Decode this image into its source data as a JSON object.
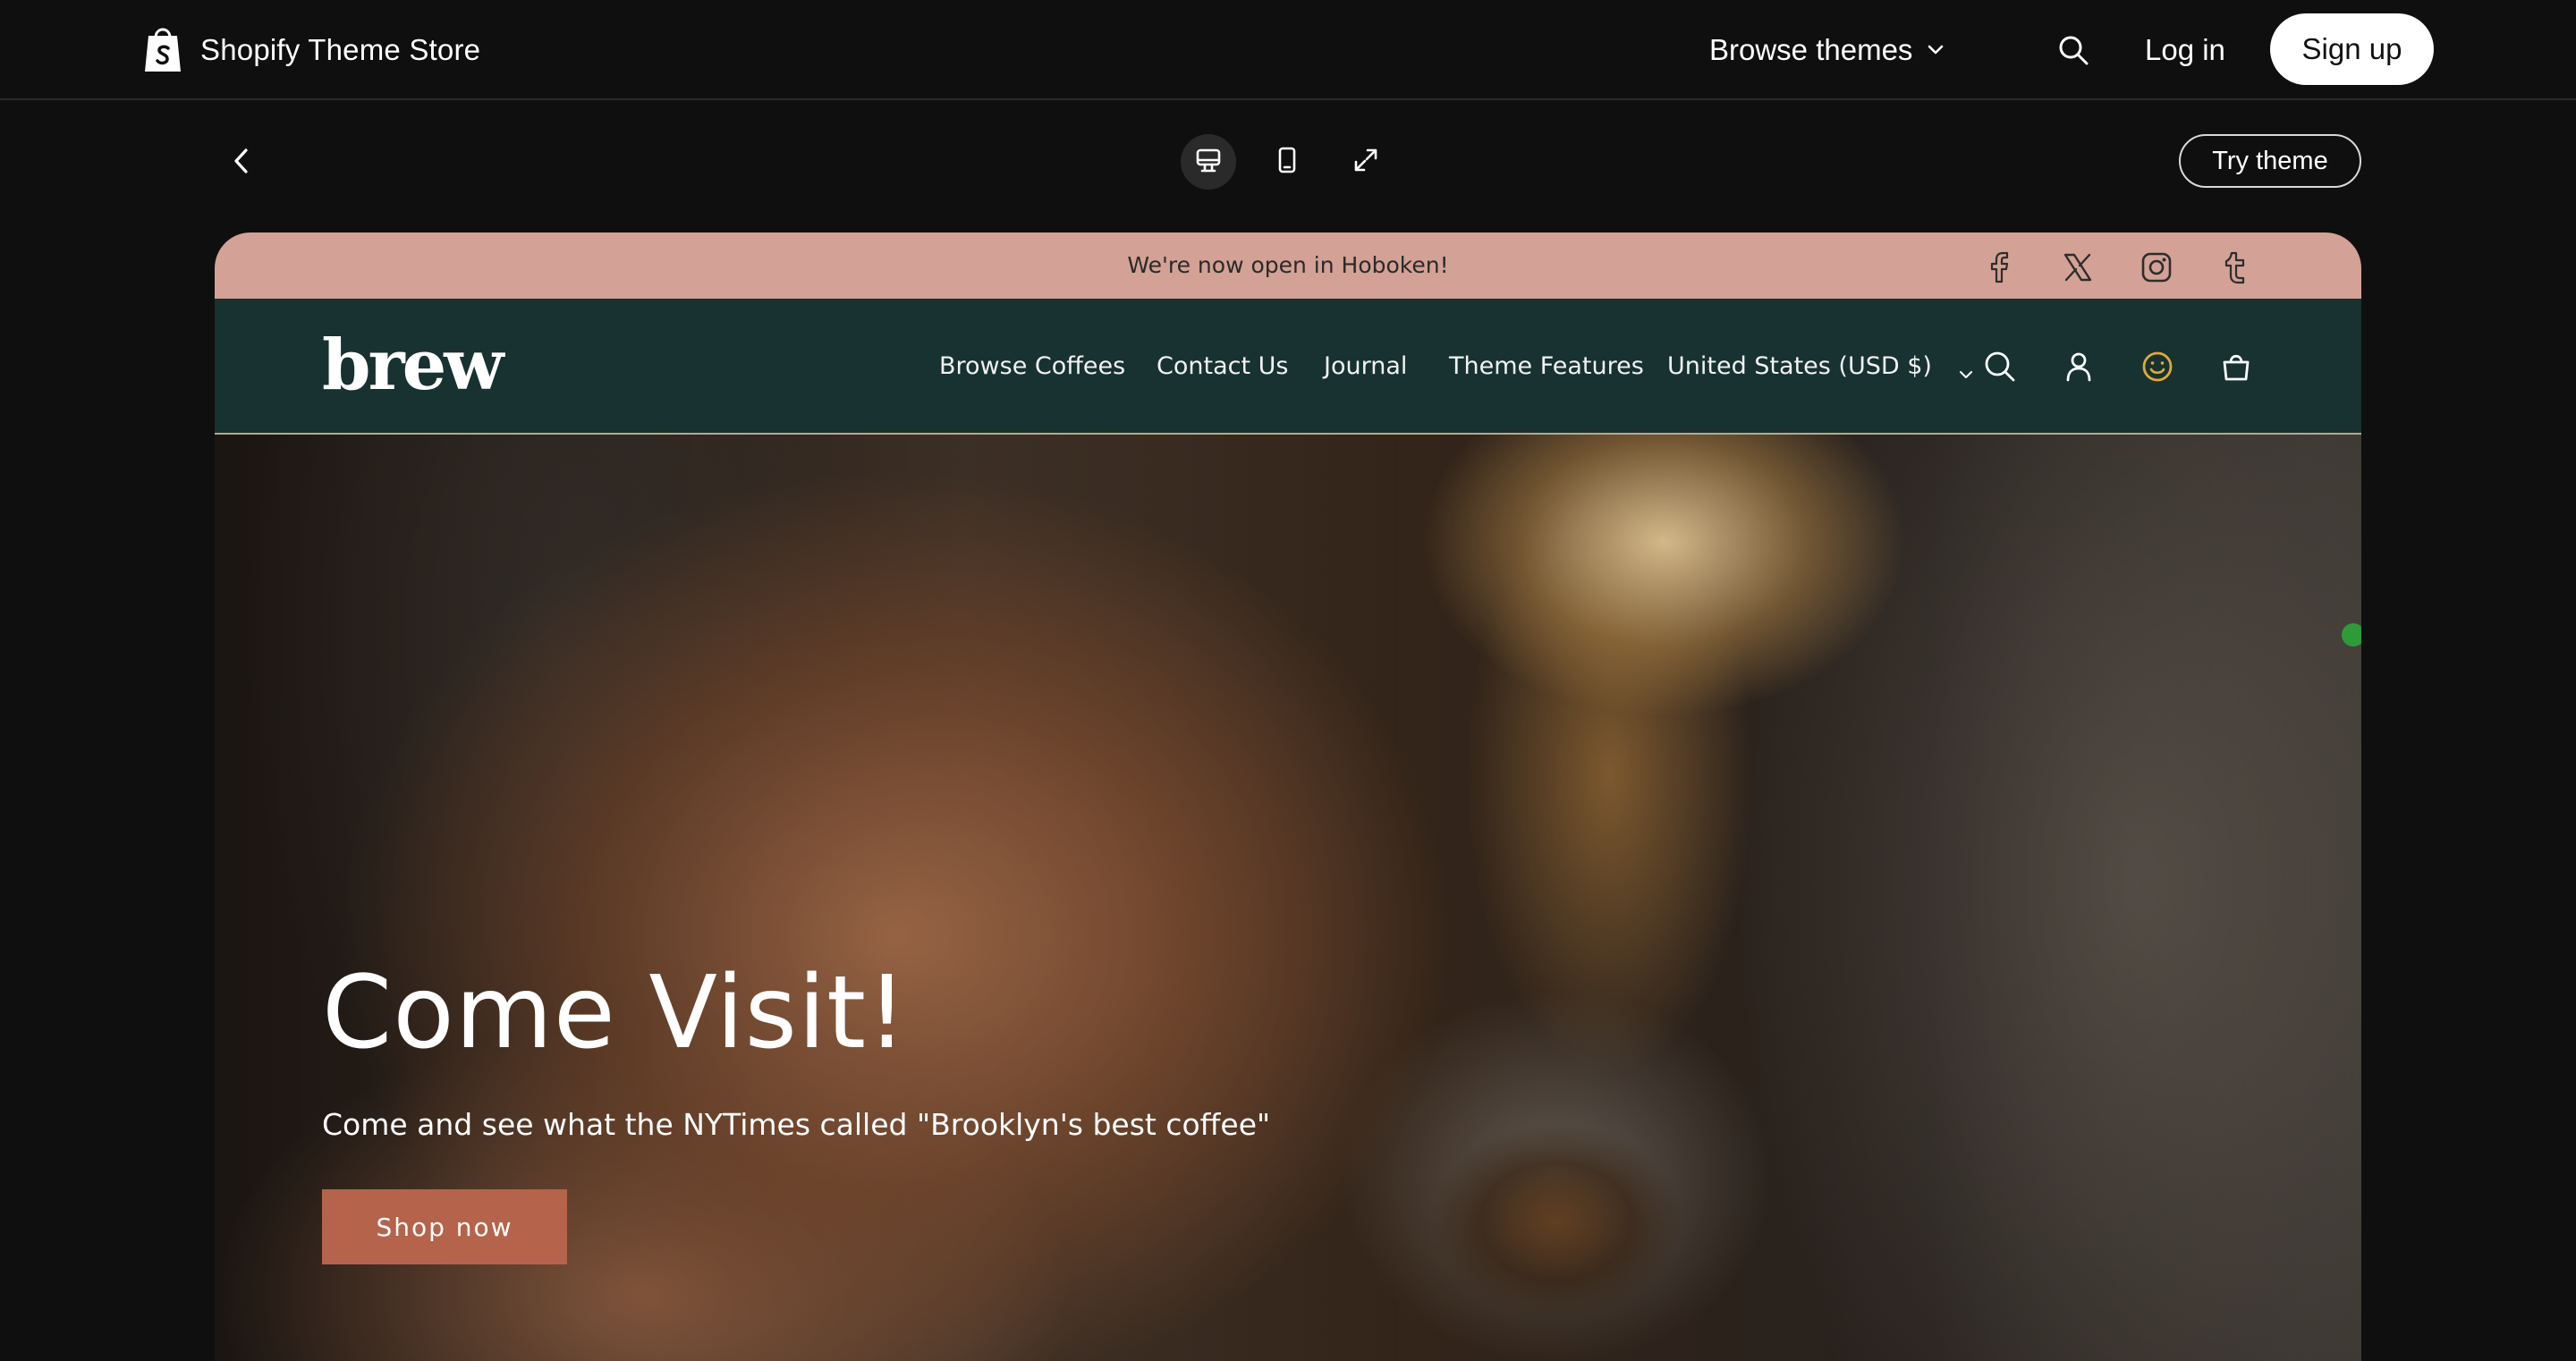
{
  "topbar": {
    "brand": "Shopify Theme Store",
    "browse_label": "Browse themes",
    "login_label": "Log in",
    "signup_label": "Sign up",
    "icons": [
      "shopify-bag-icon",
      "chevron-down-icon",
      "search-icon"
    ]
  },
  "preview_toolbar": {
    "icons": [
      "chevron-left-icon",
      "desktop-icon",
      "mobile-icon",
      "expand-icon"
    ],
    "active_view": "desktop",
    "try_label": "Try theme"
  },
  "store": {
    "announcement": "We're now open in Hoboken!",
    "social_icons": [
      "facebook-icon",
      "x-icon",
      "instagram-icon",
      "tumblr-icon"
    ],
    "logo": "brew",
    "nav": [
      "Browse Coffees",
      "Contact Us",
      "Journal",
      "Theme Features"
    ],
    "currency": "United States (USD $)",
    "nav_icons": [
      "search-icon",
      "account-icon",
      "smiley-icon",
      "cart-bag-icon"
    ],
    "colors": {
      "announcement_bg": "#d3a195",
      "header_bg": "#173230",
      "button_bg": "#b5634a",
      "smiley": "#e0a93a"
    }
  },
  "hero": {
    "title": "Come Visit!",
    "subtitle": "Come and see what the NYTimes called \"Brooklyn's best coffee\"",
    "button_label": "Shop now"
  }
}
